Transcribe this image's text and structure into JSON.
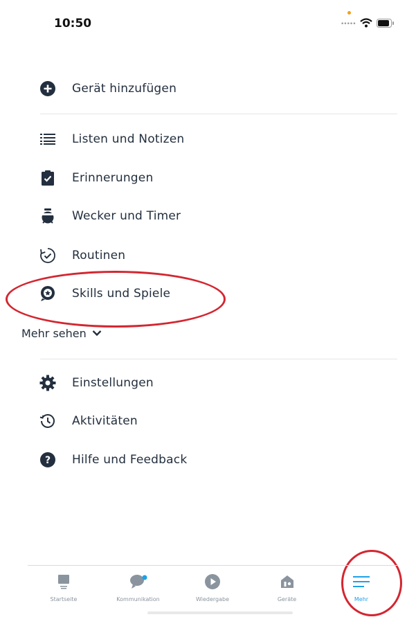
{
  "status": {
    "time": "10:50"
  },
  "menu": {
    "top_item": {
      "label": "Gerät hinzufügen",
      "icon": "plus-circle-icon"
    },
    "items": [
      {
        "label": "Listen und Notizen",
        "icon": "list-icon"
      },
      {
        "label": "Erinnerungen",
        "icon": "clipboard-check-icon"
      },
      {
        "label": "Wecker und Timer",
        "icon": "alarm-clock-icon"
      },
      {
        "label": "Routinen",
        "icon": "routine-icon"
      },
      {
        "label": "Skills und Spiele",
        "icon": "skills-icon"
      }
    ],
    "more_label": "Mehr sehen",
    "bottom_items": [
      {
        "label": "Einstellungen",
        "icon": "gear-icon"
      },
      {
        "label": "Aktivitäten",
        "icon": "history-icon"
      },
      {
        "label": "Hilfe und Feedback",
        "icon": "help-icon"
      }
    ]
  },
  "tabbar": {
    "tabs": [
      {
        "label": "Startseite",
        "icon": "home-icon"
      },
      {
        "label": "Kommunikation",
        "icon": "chat-icon"
      },
      {
        "label": "Wiedergabe",
        "icon": "play-icon"
      },
      {
        "label": "Geräte",
        "icon": "devices-icon"
      },
      {
        "label": "Mehr",
        "icon": "menu-icon",
        "active": true
      }
    ]
  },
  "colors": {
    "accent": "#1ea1e6",
    "annotation": "#d32630",
    "text": "#232f3e"
  }
}
